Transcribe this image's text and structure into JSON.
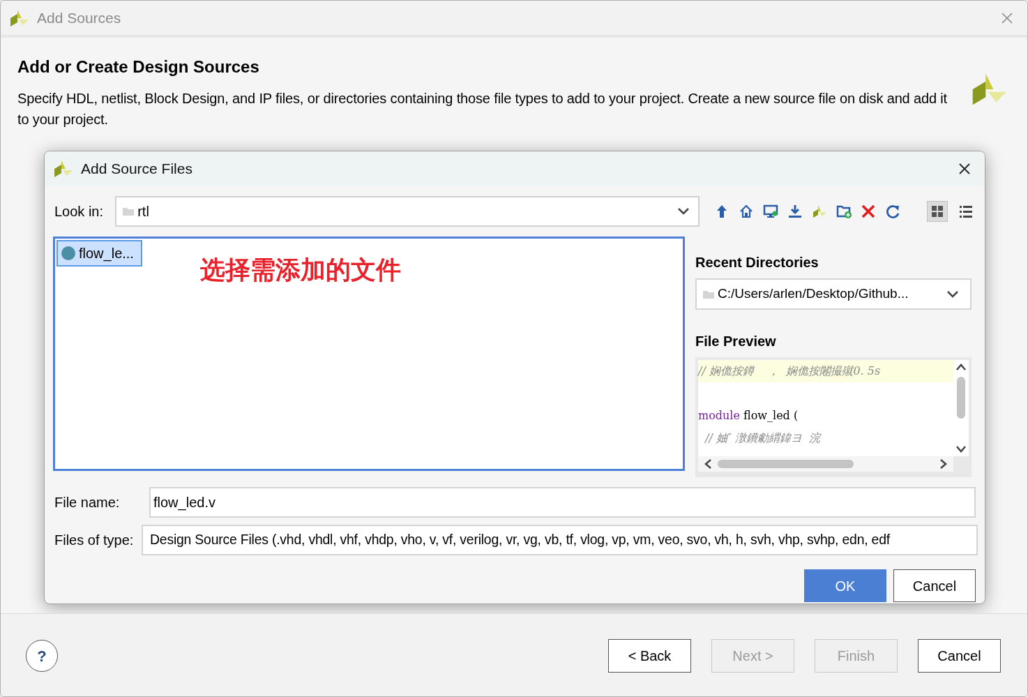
{
  "window": {
    "title": "Add Sources"
  },
  "header": {
    "title": "Add or Create Design Sources",
    "description": "Specify HDL, netlist, Block Design, and IP files, or directories containing those file types to add to your project. Create a new source file on disk and add it to your project."
  },
  "dialog": {
    "title": "Add Source Files",
    "look_in": {
      "label": "Look in:",
      "value": "rtl"
    },
    "toolbar": [
      {
        "kind": "up"
      },
      {
        "kind": "home"
      },
      {
        "kind": "desktop"
      },
      {
        "kind": "download"
      },
      {
        "kind": "logo"
      },
      {
        "kind": "new-folder"
      },
      {
        "kind": "delete"
      },
      {
        "kind": "refresh"
      },
      {
        "kind": "grid",
        "selected": true
      },
      {
        "kind": "list",
        "selected": false
      }
    ],
    "files": [
      {
        "name": "flow_le...",
        "selected": true
      }
    ],
    "annotation": "选择需添加的文件",
    "recent_directories": {
      "label": "Recent Directories",
      "value": "C:/Users/arlen/Desktop/Github..."
    },
    "file_preview": {
      "label": "File Preview",
      "lines": [
        {
          "kind": "comment",
          "text": "// 娴佹按鐏    ，  娴佹按闂撮殧0. 5s",
          "highlighted": true
        },
        {
          "kind": "blank"
        },
        {
          "kind": "module",
          "keyword": "module",
          "text": "flow_led (",
          "highlighted": false
        },
        {
          "kind": "comment",
          "text": "  // 妯″ 潡鐨勮緭鍏ヨ  浣",
          "highlighted": false
        }
      ]
    },
    "file_name": {
      "label": "File name:",
      "value": "flow_led.v"
    },
    "files_of_type": {
      "label": "Files of type:",
      "value": "Design Source Files (.vhd, vhdl, vhf, vhdp, vho, v, vf, verilog, vr, vg, vb, tf, vlog, vp, vm, veo, svo, vh, h, svh, vhp, svhp, edn, edf"
    },
    "buttons": [
      {
        "label": "OK",
        "primary": true
      },
      {
        "label": "Cancel",
        "primary": false
      }
    ]
  },
  "help": "?",
  "buttons": [
    {
      "label": "< Back",
      "disabled": false
    },
    {
      "label": "Next >",
      "disabled": true
    },
    {
      "label": "Finish",
      "disabled": true
    },
    {
      "label": "Cancel",
      "disabled": false
    }
  ]
}
